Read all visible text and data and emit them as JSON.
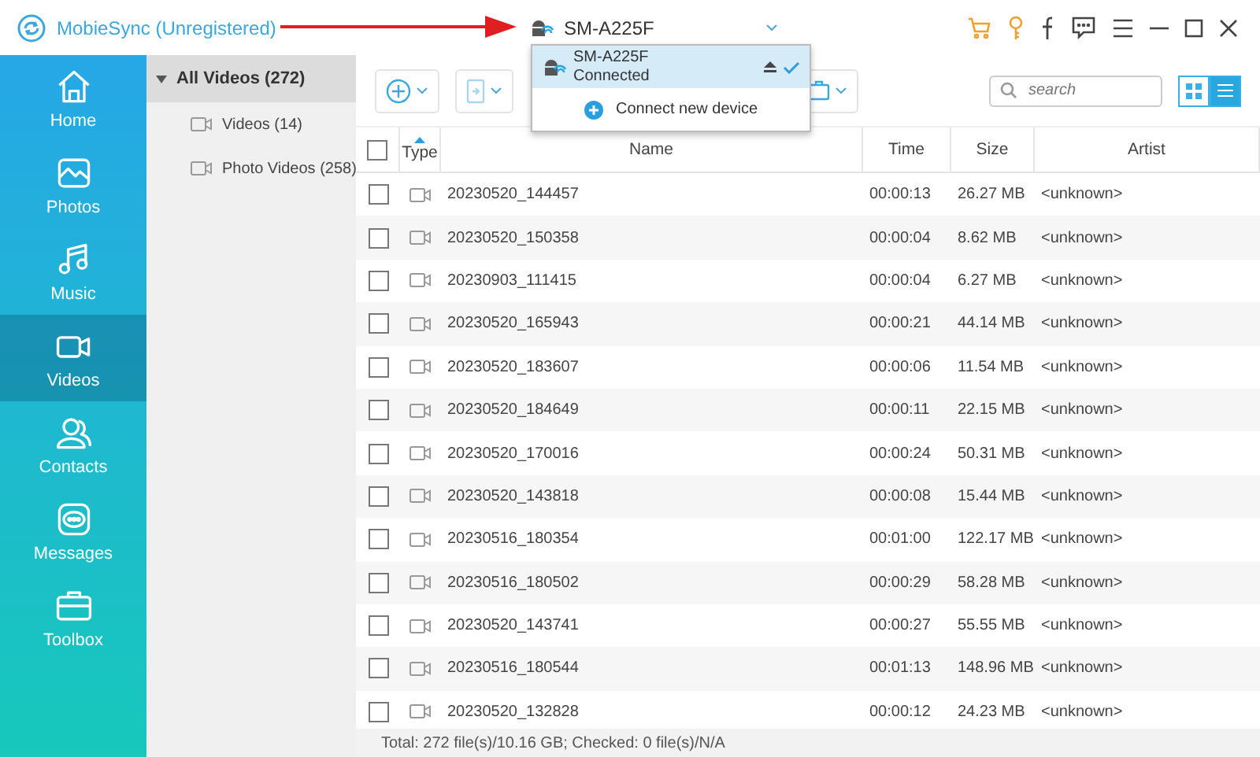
{
  "app": {
    "title": "MobieSync (Unregistered)"
  },
  "device": {
    "name": "SM-A225F"
  },
  "device_menu": {
    "items": [
      {
        "name": "SM-A225F",
        "status": "Connected",
        "selected": true
      }
    ],
    "connect_label": "Connect new device"
  },
  "sidebar": {
    "items": [
      {
        "kind": "home",
        "label": "Home",
        "selected": false
      },
      {
        "kind": "photos",
        "label": "Photos",
        "selected": false
      },
      {
        "kind": "music",
        "label": "Music",
        "selected": false
      },
      {
        "kind": "videos",
        "label": "Videos",
        "selected": true
      },
      {
        "kind": "contacts",
        "label": "Contacts",
        "selected": false
      },
      {
        "kind": "messages",
        "label": "Messages",
        "selected": false
      },
      {
        "kind": "toolbox",
        "label": "Toolbox",
        "selected": false
      }
    ]
  },
  "tree": {
    "label": "All Videos (272)",
    "expanded": true,
    "selected": true,
    "children": [
      {
        "label": "Videos (14)"
      },
      {
        "label": "Photo Videos (258)"
      }
    ]
  },
  "toolbar": {
    "search": {
      "placeholder": "search"
    },
    "view_modes": [
      {
        "kind": "grid",
        "selected": false
      },
      {
        "kind": "list",
        "selected": true
      }
    ]
  },
  "table": {
    "all_checked": false,
    "columns": [
      "Type",
      "Name",
      "Time",
      "Size",
      "Artist"
    ],
    "rows": [
      {
        "name": "20230520_144457",
        "time": "00:00:13",
        "size": "26.27 MB",
        "artist": "<unknown>",
        "checked": false
      },
      {
        "name": "20230520_150358",
        "time": "00:00:04",
        "size": "8.62 MB",
        "artist": "<unknown>",
        "checked": false
      },
      {
        "name": "20230903_111415",
        "time": "00:00:04",
        "size": "6.27 MB",
        "artist": "<unknown>",
        "checked": false
      },
      {
        "name": "20230520_165943",
        "time": "00:00:21",
        "size": "44.14 MB",
        "artist": "<unknown>",
        "checked": false
      },
      {
        "name": "20230520_183607",
        "time": "00:00:06",
        "size": "11.54 MB",
        "artist": "<unknown>",
        "checked": false
      },
      {
        "name": "20230520_184649",
        "time": "00:00:11",
        "size": "22.15 MB",
        "artist": "<unknown>",
        "checked": false
      },
      {
        "name": "20230520_170016",
        "time": "00:00:24",
        "size": "50.31 MB",
        "artist": "<unknown>",
        "checked": false
      },
      {
        "name": "20230520_143818",
        "time": "00:00:08",
        "size": "15.44 MB",
        "artist": "<unknown>",
        "checked": false
      },
      {
        "name": "20230516_180354",
        "time": "00:01:00",
        "size": "122.17 MB",
        "artist": "<unknown>",
        "checked": false
      },
      {
        "name": "20230516_180502",
        "time": "00:00:29",
        "size": "58.28 MB",
        "artist": "<unknown>",
        "checked": false
      },
      {
        "name": "20230520_143741",
        "time": "00:00:27",
        "size": "55.55 MB",
        "artist": "<unknown>",
        "checked": false
      },
      {
        "name": "20230516_180544",
        "time": "00:01:13",
        "size": "148.96 MB",
        "artist": "<unknown>",
        "checked": false
      },
      {
        "name": "20230520_132828",
        "time": "00:00:12",
        "size": "24.23 MB",
        "artist": "<unknown>",
        "checked": false
      }
    ]
  },
  "status_bar": {
    "text": "Total: 272 file(s)/10.16 GB; Checked: 0 file(s)/N/A"
  }
}
